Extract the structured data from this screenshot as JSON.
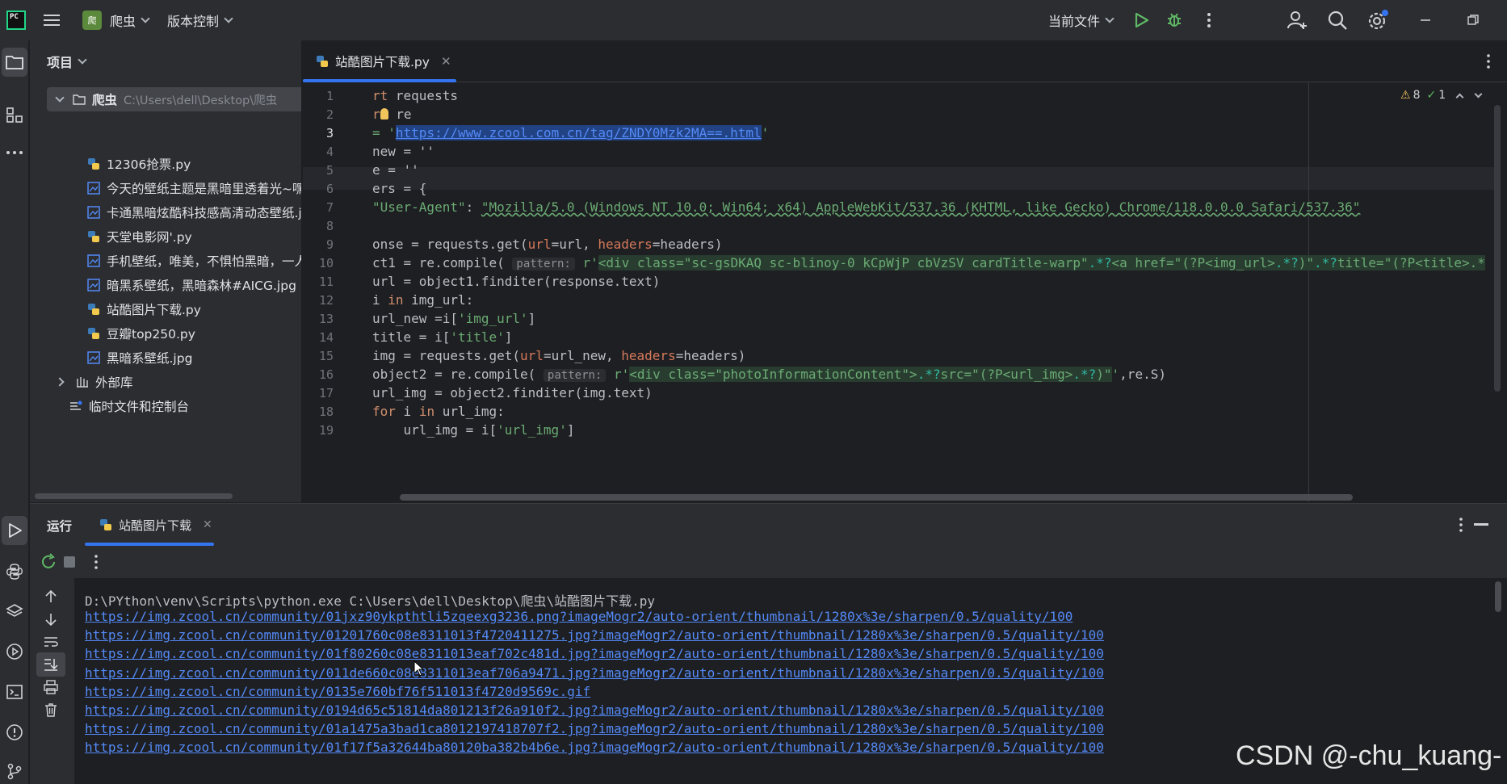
{
  "titlebar": {
    "project_badge": "爬",
    "project_name": "爬虫",
    "vcs": "版本控制",
    "run_config": "当前文件"
  },
  "project_panel": {
    "title": "项目",
    "root_name": "爬虫",
    "root_path": "C:\\Users\\dell\\Desktop\\爬虫",
    "files": [
      {
        "name": "12306抢票.py",
        "type": "py"
      },
      {
        "name": "今天的壁纸主题是黑暗里透着光~嘿嘿",
        "type": "img"
      },
      {
        "name": "卡通黑暗炫酷科技感高清动态壁纸.jpg",
        "type": "img"
      },
      {
        "name": "天堂电影网'.py",
        "type": "py"
      },
      {
        "name": "手机壁纸，唯美，不惧怕黑暗，一人",
        "type": "img"
      },
      {
        "name": "暗黑系壁纸，黑暗森林#AICG.jpg",
        "type": "img"
      },
      {
        "name": "站酷图片下载.py",
        "type": "py"
      },
      {
        "name": "豆瓣top250.py",
        "type": "py"
      },
      {
        "name": "黑暗系壁纸.jpg",
        "type": "img"
      }
    ],
    "external_libs": "外部库",
    "scratches": "临时文件和控制台"
  },
  "editor": {
    "tab_name": "站酷图片下载.py",
    "warnings": "8",
    "typos": "1",
    "line_numbers": [
      "1",
      "2",
      "3",
      "4",
      "5",
      "6",
      "7",
      "8",
      "9",
      "10",
      "11",
      "12",
      "13",
      "14",
      "15",
      "16",
      "17",
      "18",
      "19"
    ],
    "code": {
      "l1_a": "rt",
      "l1_b": " requests",
      "l2_a": "r",
      "l2_b": " re",
      "l3_a": "= '",
      "l3_url": "https://www.zcool.com.cn/tag/ZNDY0Mzk2MA==.html",
      "l3_b": "'",
      "l4": "new = ''",
      "l5": "e = ''",
      "l6": "ers = {",
      "l7_a": "\"User-Agent\"",
      "l7_b": ": ",
      "l7_c": "\"Mozilla/5.0 (Windows NT 10.0; Win64; x64) AppleWebKit/537.36 (KHTML, like Gecko) Chrome/118.0.0.0 Safari/537.36\"",
      "l9_a": "onse = requests.get(",
      "l9_p1": "url",
      "l9_b": "=url, ",
      "l9_p2": "headers",
      "l9_c": "=headers)",
      "l10_a": "ct1 = re.compile( ",
      "l10_hint": "pattern:",
      "l10_r": " r'",
      "l10_rx1": "<div class=\"sc-gsDKAQ sc-blinoy-0 kCpWjP cbVzSV cardTitle-warp\"",
      "l10_rx2": ".*?",
      "l10_rx3": "<a href=\"(?P<img_url>",
      "l10_rx4": ".*?",
      "l10_rx5": ")\"",
      "l10_rx6": ".*?",
      "l10_rx7": "title=\"(?P<title>.*",
      "l11": "url = object1.finditer(response.text)",
      "l12_a": "i ",
      "l12_kw": "in",
      "l12_b": " img_url:",
      "l13_a": "url_new =i[",
      "l13_s": "'img_url'",
      "l13_b": "]",
      "l14_a": "title = i[",
      "l14_s": "'title'",
      "l14_b": "]",
      "l15_a": "img = requests.get(",
      "l15_p1": "url",
      "l15_b": "=url_new, ",
      "l15_p2": "headers",
      "l15_c": "=headers)",
      "l16_a": "object2 = re.compile( ",
      "l16_hint": "pattern:",
      "l16_r": " r'",
      "l16_rx1": "<div class=\"photoInformationContent\">",
      "l16_rx2": ".*?",
      "l16_rx3": "src=\"(?P<url_img>",
      "l16_rx4": ".*?",
      "l16_rx5": ")\"",
      "l16_b": "'",
      "l16_c": ",re.S)",
      "l17": "url_img = object2.finditer(img.text)",
      "l18_kw1": "for",
      "l18_a": " i ",
      "l18_kw2": "in",
      "l18_b": " url_img:",
      "l19_a": "    url_img = i[",
      "l19_s": "'url_img'",
      "l19_b": "]"
    }
  },
  "run_panel": {
    "title": "运行",
    "tab_name": "站酷图片下载",
    "command": "D:\\PYthon\\venv\\Scripts\\python.exe C:\\Users\\dell\\Desktop\\爬虫\\站酷图片下载.py",
    "output_links": [
      "https://img.zcool.cn/community/01jxz90ykpthtli5zqeexg3236.png?imageMogr2/auto-orient/thumbnail/1280x%3e/sharpen/0.5/quality/100",
      "https://img.zcool.cn/community/01201760c08e8311013f4720411275.jpg?imageMogr2/auto-orient/thumbnail/1280x%3e/sharpen/0.5/quality/100",
      "https://img.zcool.cn/community/01f80260c08e8311013eaf702c481d.jpg?imageMogr2/auto-orient/thumbnail/1280x%3e/sharpen/0.5/quality/100",
      "https://img.zcool.cn/community/011de660c08e8311013eaf706a9471.jpg?imageMogr2/auto-orient/thumbnail/1280x%3e/sharpen/0.5/quality/100",
      "https://img.zcool.cn/community/0135e760bf76f511013f4720d9569c.gif",
      "https://img.zcool.cn/community/0194d65c51814da801213f26a910f2.jpg?imageMogr2/auto-orient/thumbnail/1280x%3e/sharpen/0.5/quality/100",
      "https://img.zcool.cn/community/01a1475a3bad1ca8012197418707f2.jpg?imageMogr2/auto-orient/thumbnail/1280x%3e/sharpen/0.5/quality/100",
      "https://img.zcool.cn/community/01f17f5a32644ba80120ba382b4b6e.jpg?imageMogr2/auto-orient/thumbnail/1280x%3e/sharpen/0.5/quality/100"
    ]
  },
  "watermark": "CSDN @-chu_kuang-",
  "colors": {
    "background": "#1e1f22",
    "panel": "#2b2d30",
    "accent": "#3574f0",
    "link": "#548af7",
    "string": "#6aab73",
    "keyword": "#cf8e6d",
    "run_green": "#5fb865"
  },
  "icons": {
    "app": "pycharm-logo",
    "menu": "hamburger-icon",
    "run": "run-icon",
    "debug": "debug-icon",
    "search": "search-icon",
    "settings": "gear-icon",
    "user": "add-user-icon"
  }
}
